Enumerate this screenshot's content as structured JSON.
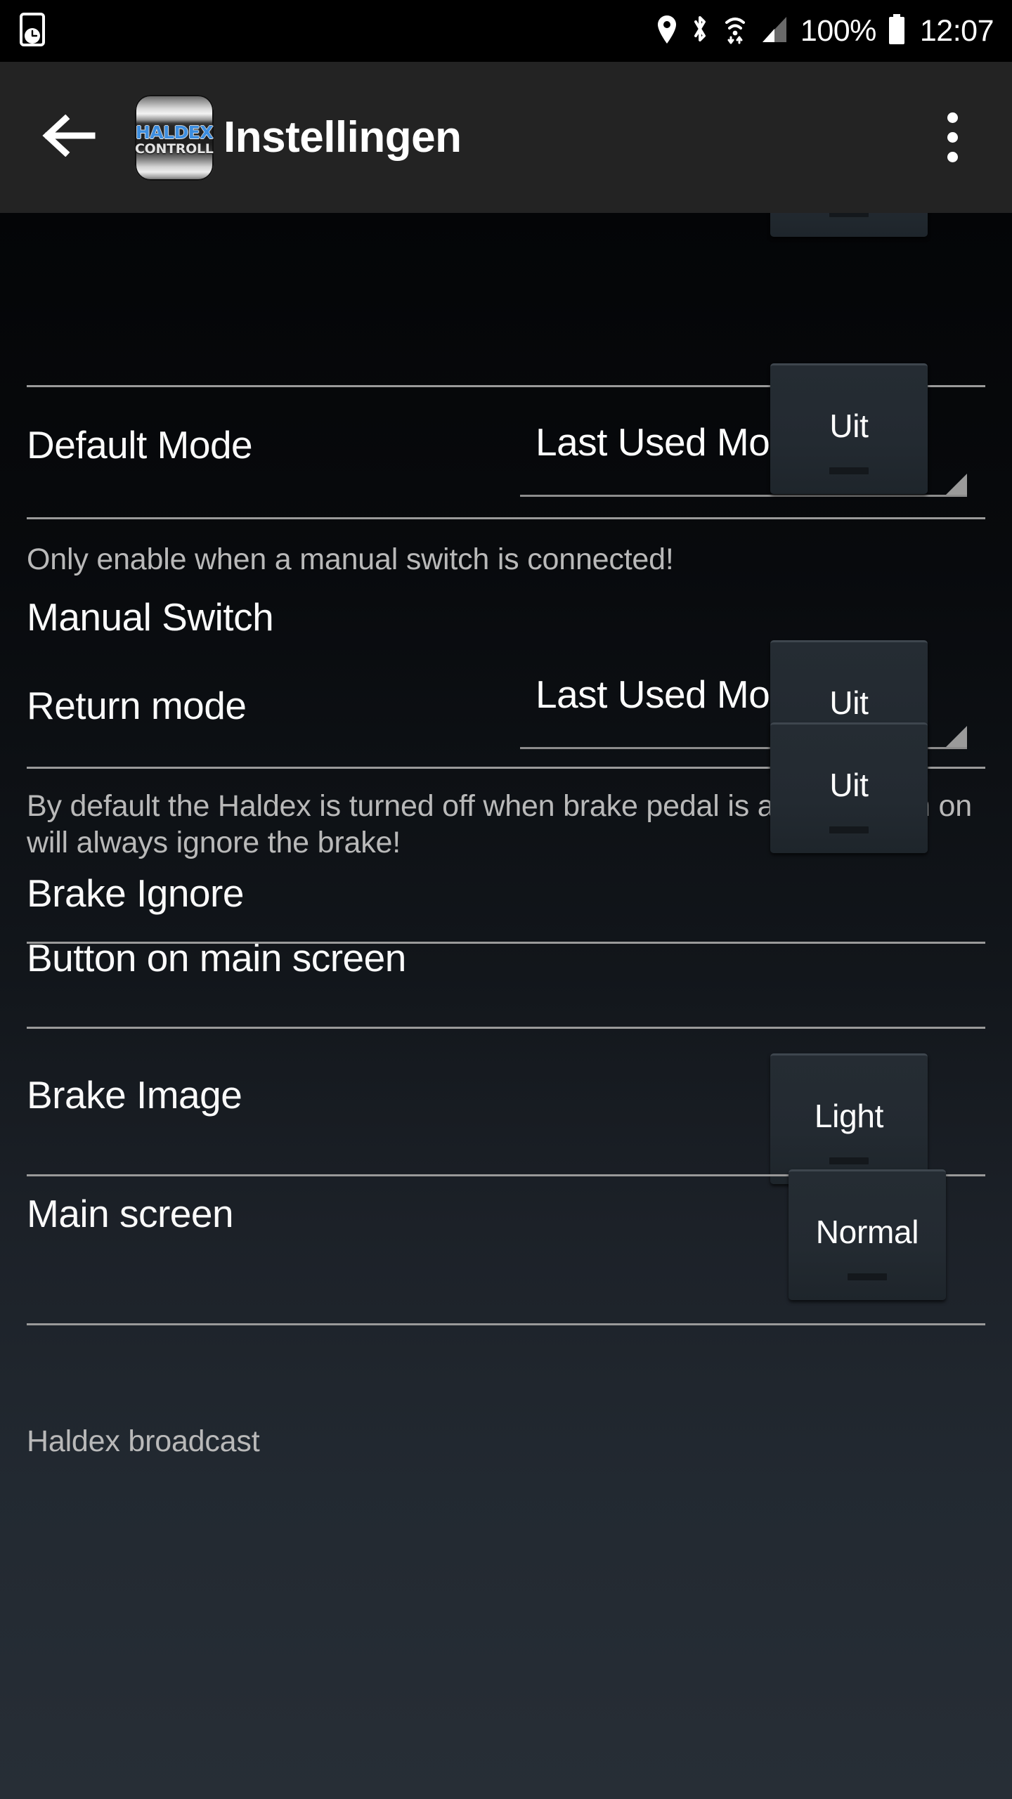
{
  "status_bar": {
    "icons": [
      "device-clock-icon",
      "location-pin-icon",
      "bluetooth-icon",
      "wifi-icon",
      "cellular-signal-icon",
      "battery-icon"
    ],
    "battery_percent": "100%",
    "clock": "12:07"
  },
  "toolbar": {
    "back_icon": "arrow-left-icon",
    "logo": {
      "line1": "HALDEX",
      "line2": "CONTROLLER",
      "accent_color": "#3d8ee0"
    },
    "title": "Instellingen",
    "overflow_icon": "overflow-menu-icon"
  },
  "settings": {
    "default_mode": {
      "label": "Default Mode",
      "value": "Last Used Mode"
    },
    "manual_switch": {
      "help": "Only enable when a manual switch is connected!",
      "label": "Manual Switch",
      "value": "Uit"
    },
    "return_mode": {
      "label": "Return mode",
      "value": "Last Used Mode"
    },
    "brake_help": "By default the Haldex is turned off when brake pedal is applied. Turn on will always ignore the brake!",
    "brake_ignore": {
      "label": "Brake Ignore",
      "value": "Uit"
    },
    "button_on_main_screen": {
      "label": "Button on main screen",
      "value": "Uit"
    },
    "brake_image": {
      "label": "Brake Image",
      "value": "Light"
    },
    "main_screen": {
      "label": "Main screen",
      "value": "Normal"
    },
    "haldex_broadcast": {
      "label": "Haldex broadcast"
    }
  },
  "colors": {
    "toolbar_bg": "#232323",
    "status_bar_bg": "#000000",
    "content_top_bg": "#040507",
    "content_bottom_bg": "#272e36",
    "button_bg": "#232a31",
    "divider": "#9a9a9a",
    "text_primary": "#fafafa",
    "text_secondary": "#b9b9b9"
  }
}
